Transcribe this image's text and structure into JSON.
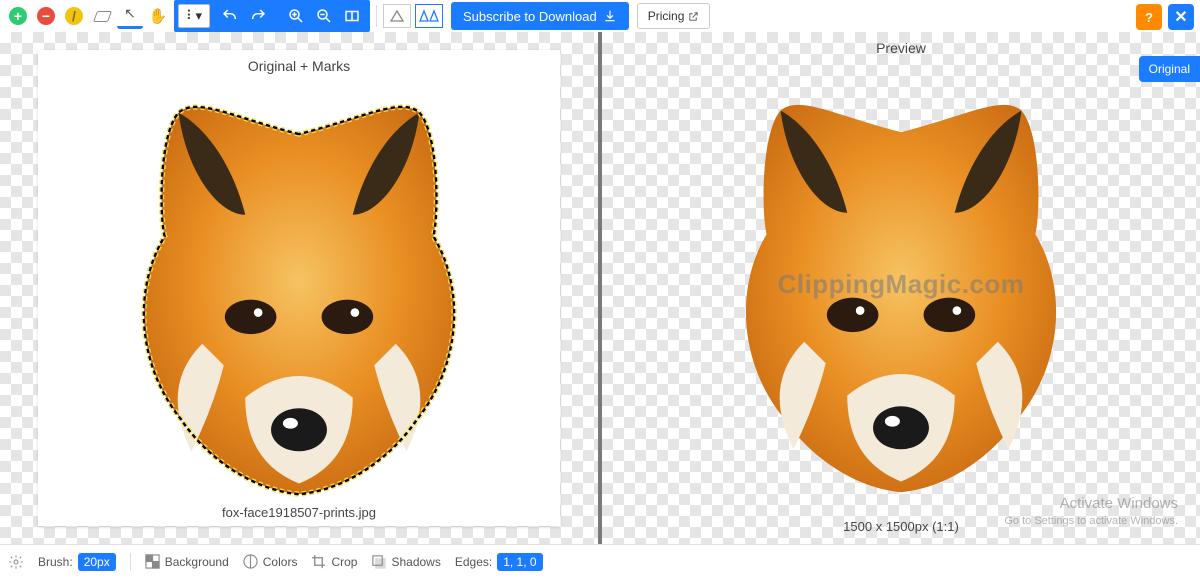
{
  "toolbar": {
    "dropdown_label": "⠇",
    "subscribe_label": "Subscribe to Download",
    "pricing_label": "Pricing"
  },
  "panes": {
    "left_title": "Original + Marks",
    "right_title": "Preview",
    "filename": "fox-face1918507-prints.jpg",
    "dimensions": "1500 x 1500px (1:1)",
    "watermark": "ClippingMagic.com"
  },
  "side": {
    "original_label": "Original"
  },
  "bottom": {
    "brush_label": "Brush:",
    "brush_value": "20px",
    "background_label": "Background",
    "colors_label": "Colors",
    "crop_label": "Crop",
    "shadows_label": "Shadows",
    "edges_label": "Edges:",
    "edges_value": "1, 1, 0"
  },
  "os": {
    "activate_title": "Activate Windows",
    "activate_sub": "Go to Settings to activate Windows."
  }
}
